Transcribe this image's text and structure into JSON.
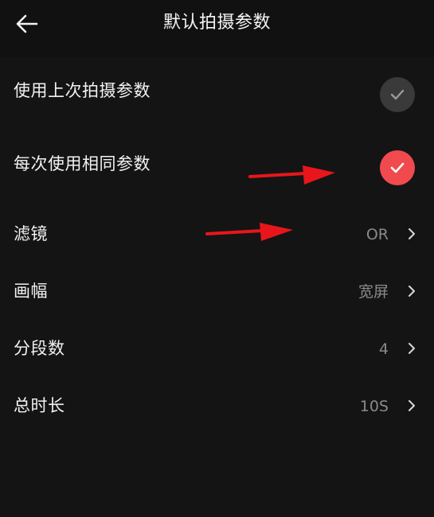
{
  "header": {
    "title": "默认拍摄参数",
    "back_icon": "arrow-left-icon"
  },
  "mode_options": [
    {
      "label": "使用上次拍摄参数",
      "selected": false
    },
    {
      "label": "每次使用相同参数",
      "selected": true
    }
  ],
  "settings": [
    {
      "label": "滤镜",
      "value": "OR"
    },
    {
      "label": "画幅",
      "value": "宽屏"
    },
    {
      "label": "分段数",
      "value": "4"
    },
    {
      "label": "总时长",
      "value": "10S"
    }
  ],
  "colors": {
    "background": "#141414",
    "accent": "#f04a4f",
    "unselected": "#3a3a3a",
    "value_text": "#8a8a8a",
    "annotation": "#e8161b"
  },
  "icons": {
    "check": "check-icon",
    "chevron": "chevron-right-icon"
  }
}
